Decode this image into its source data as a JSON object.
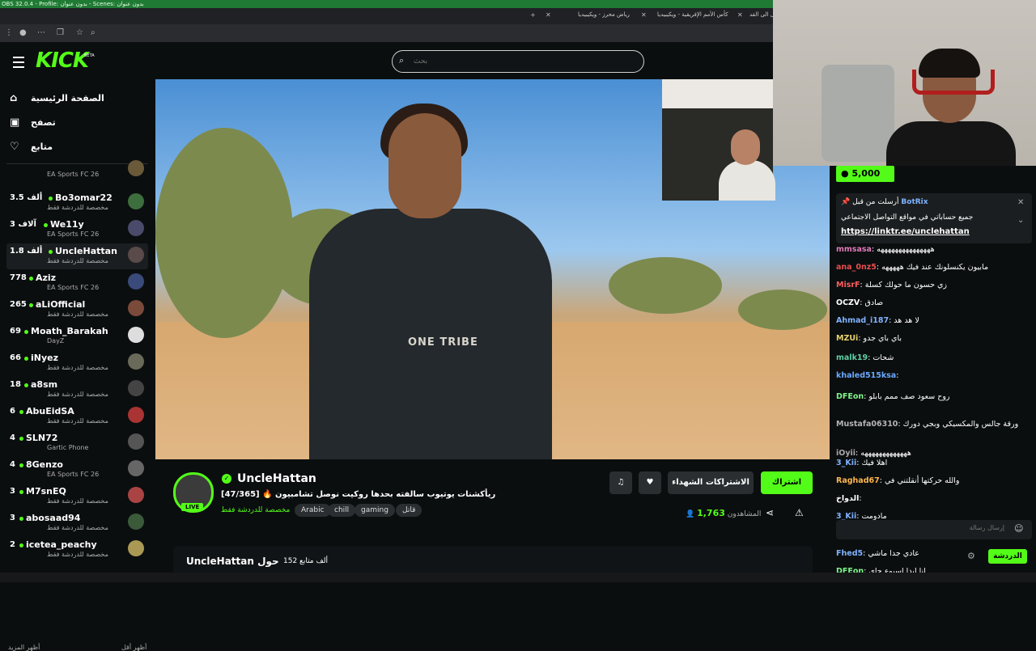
{
  "obs": {
    "title": "OBS 32.0.4 - Profile: بدون عنوان - Scenes: بدون عنوان"
  },
  "browser": {
    "tabs": [
      "رياض محرز - ويكيبيديا",
      "كأس الأمم الإفريقية - ويكيبيديا",
      "عمل الى القد..."
    ]
  },
  "header": {
    "logo": "KICK",
    "logo_beta": "BETA",
    "search_placeholder": "بحث"
  },
  "nav": {
    "home": "الصفحة الرئيسية",
    "browse": "تصفح",
    "following": "متابع"
  },
  "channels": [
    {
      "count": "",
      "name": "",
      "category": "EA Sports FC 26"
    },
    {
      "count": "3.5 ألف",
      "name": "Bo3omar22",
      "category": "مخصصة للدردشة فقط"
    },
    {
      "count": "3 آلاف",
      "name": "We11y",
      "category": "EA Sports FC 26"
    },
    {
      "count": "1.8 ألف",
      "name": "UncleHattan",
      "category": "مخصصة للدردشة فقط"
    },
    {
      "count": "778",
      "name": "Aziz",
      "category": "EA Sports FC 26"
    },
    {
      "count": "265",
      "name": "aLiOfficial",
      "category": "مخصصة للدردشة فقط"
    },
    {
      "count": "69",
      "name": "Moath_Barakah",
      "category": "DayZ"
    },
    {
      "count": "66",
      "name": "iNyez",
      "category": "مخصصة للدردشة فقط"
    },
    {
      "count": "18",
      "name": "a8sm",
      "category": "مخصصة للدردشة فقط"
    },
    {
      "count": "6",
      "name": "AbuEidSA",
      "category": "مخصصة للدردشة فقط"
    },
    {
      "count": "4",
      "name": "SLN72",
      "category": "Gartic Phone"
    },
    {
      "count": "4",
      "name": "8Genzo",
      "category": "EA Sports FC 26"
    },
    {
      "count": "3",
      "name": "M7snEQ",
      "category": "مخصصة للدردشة فقط"
    },
    {
      "count": "3",
      "name": "abosaad94",
      "category": "مخصصة للدردشة فقط"
    },
    {
      "count": "2",
      "name": "icetea_peachy",
      "category": "مخصصة للدردشة فقط"
    }
  ],
  "sidebar_more": {
    "left": "أظهر المزيد",
    "right": "أظهر أقل"
  },
  "video": {
    "shirt_text": "ONE TRIBE"
  },
  "stream": {
    "streamer": "UncleHattan",
    "live_label": "LIVE",
    "title": "ريأكشنات يوتيوب سالفته بحدها روكيت نوصل تشامبيون 🔥 [47/365]",
    "category": "مخصصة للدردشة فقط",
    "tags": [
      "Arabic",
      "chill",
      "gaming",
      "قاتل"
    ],
    "subscribe_label": "اشتراك",
    "gift_label": "الاشتراكات الشهداء",
    "viewers_count": "1,763",
    "viewers_label": "المشاهدون",
    "about_title": "UncleHattan حول",
    "followers": "152 ألف متابع"
  },
  "chat": {
    "sub_badge": "5,000",
    "pinned_by": "أرسلت من قبل",
    "pinned_user": "BotRix",
    "pinned_msg": "جميع حساباتي في مواقع التواصل الاجتماعي",
    "pinned_link": "https://linktr.ee/unclehattan",
    "messages": [
      {
        "user": "mmsasa",
        "color": "#e07ab8",
        "text": "هههههههههههههههه"
      },
      {
        "user": "ana_0nz5",
        "color": "#e84f4f",
        "text": "مابيون يكنسلونك عند فيك هههههه"
      },
      {
        "user": "MisrF",
        "color": "#ff5d5d",
        "text": "زي حسون ما حولك كسلة"
      },
      {
        "user": "OCZV",
        "color": "#ffffff",
        "text": "صادق"
      },
      {
        "user": "Ahmad_i187",
        "color": "#7fb3ff",
        "text": "لا هد هد"
      },
      {
        "user": "MZUi",
        "color": "#e6d36b",
        "text": "باي باي جدو"
      },
      {
        "user": "malk19",
        "color": "#5ed1a5",
        "text": "شحات"
      },
      {
        "user": "khaled515ksa",
        "color": "#6aa8ff",
        "text": ""
      },
      {
        "user": "DFEon",
        "color": "#7ff58a",
        "text": "روح سعود صف ممم بابلو"
      },
      {
        "user": "Mustafa06310",
        "color": "#b4b4b4",
        "text": "ورقة جالس والمكسيكي وبجي دورك"
      },
      {
        "user": "iOyii",
        "color": "#aaaaaa",
        "text": "هههههههههههههه"
      },
      {
        "user": "3_Kii",
        "color": "#7fb3ff",
        "text": "اهلا فيك"
      },
      {
        "user": "Raghad67",
        "color": "#ffb74d",
        "text": "والله حركتها أنقلتني في"
      },
      {
        "user": "الدواخ",
        "color": "#ffffff",
        "text": ""
      },
      {
        "user": "3_Kii",
        "color": "#7fb3ff",
        "text": "مادومت"
      },
      {
        "user": "3_Kii",
        "color": "#7fb3ff",
        "text": ""
      },
      {
        "user": "Fhed5",
        "color": "#7fb3ff",
        "text": "عادي جدا ماشي"
      },
      {
        "user": "DFEon",
        "color": "#7ff58a",
        "text": "انا ابدا اسبوع جاي"
      }
    ],
    "input_placeholder": "إرسال رسالة",
    "send_label": "الدردشة"
  }
}
